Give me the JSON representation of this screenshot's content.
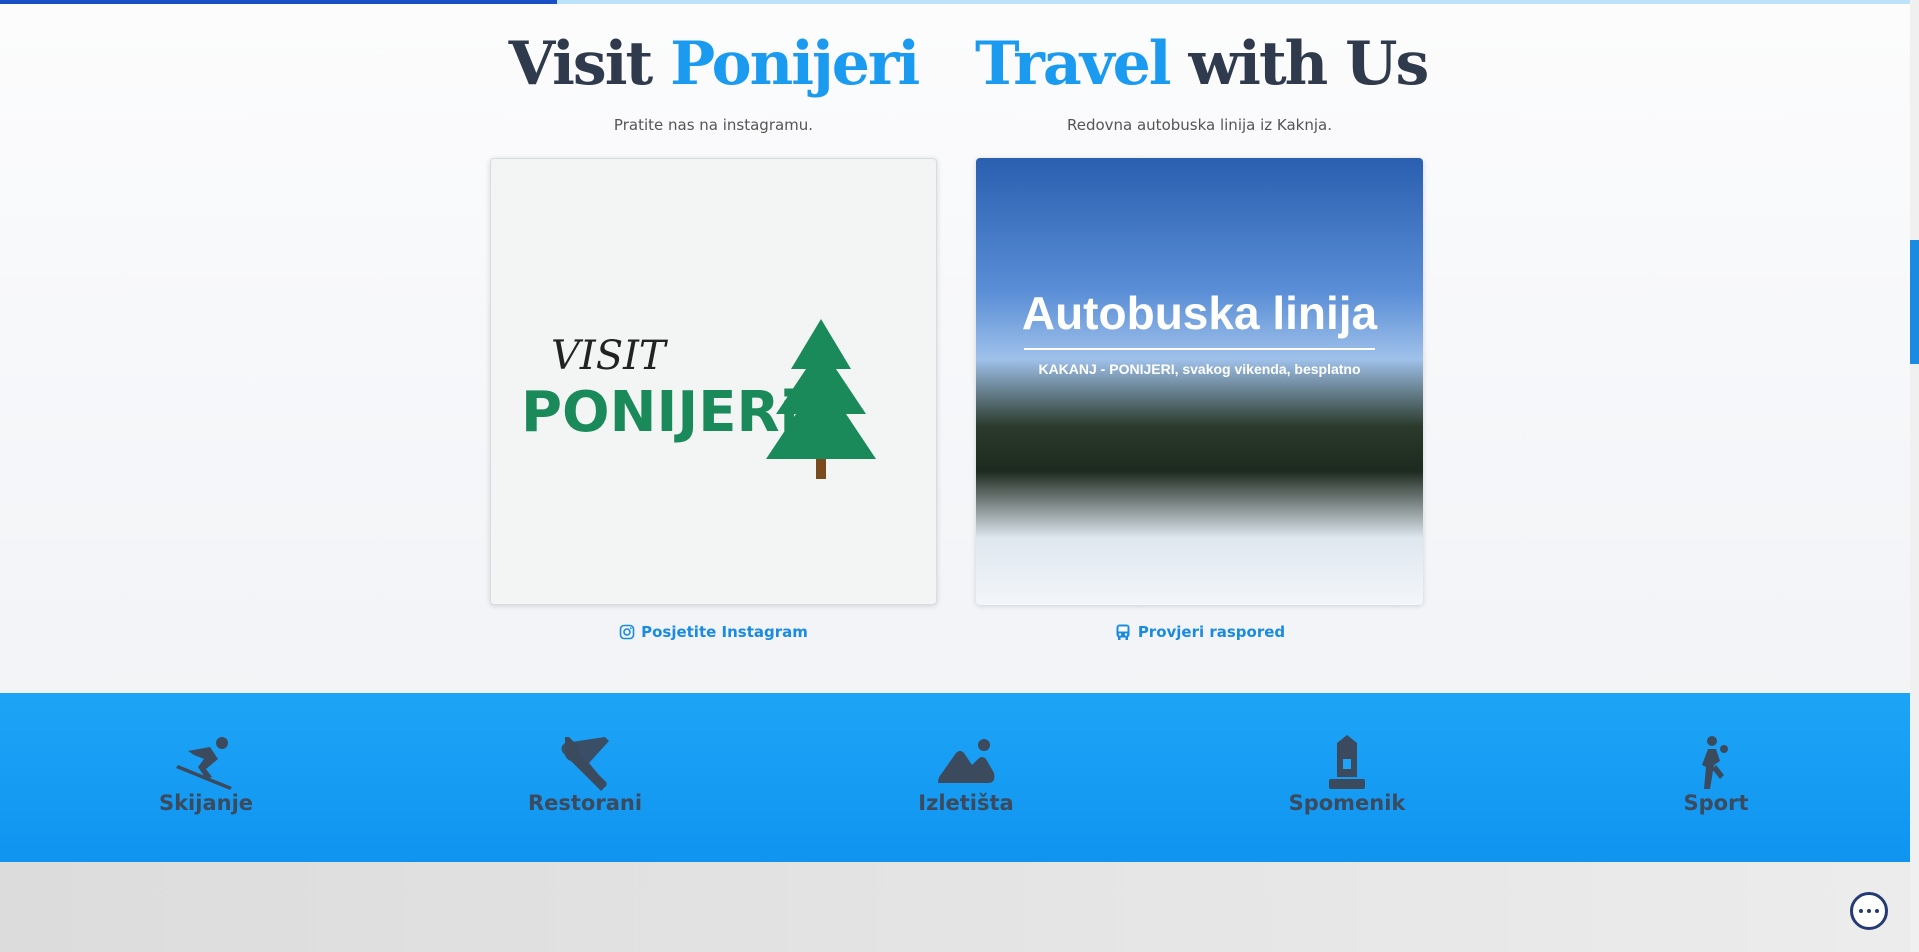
{
  "progress": {
    "fraction": 0.29
  },
  "left": {
    "heading_dark": "Visit",
    "heading_accent": "Ponijeri",
    "subtitle": "Pratite nas na instagramu.",
    "link_label": "Posjetite Instagram",
    "logo_text_top": "VISIT",
    "logo_text_bottom": "PONIJERi"
  },
  "right": {
    "heading_accent": "Travel",
    "heading_dark": "with Us",
    "subtitle": "Redovna autobuska linija iz Kaknja.",
    "link_label": "Provjeri raspored",
    "card_title": "Autobuska linija",
    "card_subtitle": "KAKANJ - PONIJERI, svakog vikenda, besplatno"
  },
  "features": [
    {
      "label": "Skijanje",
      "icon": "skiing-icon"
    },
    {
      "label": "Restorani",
      "icon": "utensils-icon"
    },
    {
      "label": "Izletišta",
      "icon": "mountain-icon"
    },
    {
      "label": "Spomenik",
      "icon": "monument-icon"
    },
    {
      "label": "Sport",
      "icon": "volleyball-player-icon"
    }
  ],
  "colors": {
    "accent": "#1a9bf0",
    "dark": "#2f3a4d",
    "band": "#1ea4f6",
    "link": "#1a8be0"
  }
}
